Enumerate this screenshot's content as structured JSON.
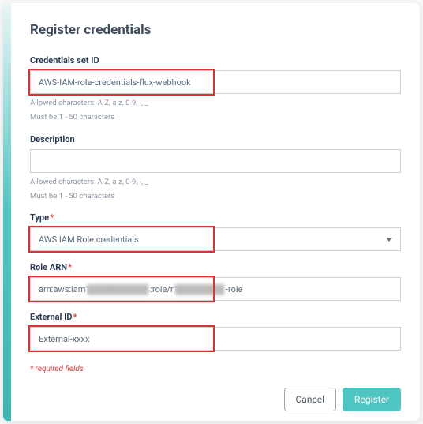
{
  "dialog": {
    "title": "Register credentials"
  },
  "fields": {
    "credentials_id": {
      "label": "Credentials set ID",
      "value": "AWS-IAM-role-credentials-flux-webhook",
      "help1": "Allowed characters: A-Z, a-z, 0-9, -, _",
      "help2": "Must be 1 - 50 characters"
    },
    "description": {
      "label": "Description",
      "value": "",
      "help1": "Allowed characters: A-Z, a-z, 0-9, -, _",
      "help2": "Must be 1 - 50 characters"
    },
    "type": {
      "label": "Type",
      "value": "AWS IAM Role credentials"
    },
    "role_arn": {
      "label": "Role ARN",
      "prefix": "arn:aws:iam",
      "mid": ":role/r",
      "suffix": "-role"
    },
    "external_id": {
      "label": "External ID",
      "value": "External-xxxx"
    }
  },
  "required_note": "* required fields",
  "buttons": {
    "cancel": "Cancel",
    "register": "Register"
  }
}
